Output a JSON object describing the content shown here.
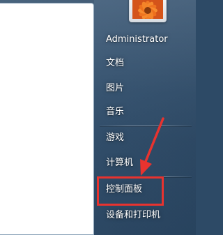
{
  "start_menu": {
    "user": {
      "name": "Administrator",
      "avatar_icon": "flower-avatar-icon"
    },
    "right_items": [
      {
        "label": "文档"
      },
      {
        "label": "图片"
      },
      {
        "label": "音乐"
      },
      {
        "label": "游戏"
      },
      {
        "label": "计算机"
      },
      {
        "label": "控制面板"
      },
      {
        "label": "设备和打印机"
      }
    ]
  },
  "annotation": {
    "highlight_color": "#e8332f",
    "arrow_icon": "red-arrow-icon"
  }
}
